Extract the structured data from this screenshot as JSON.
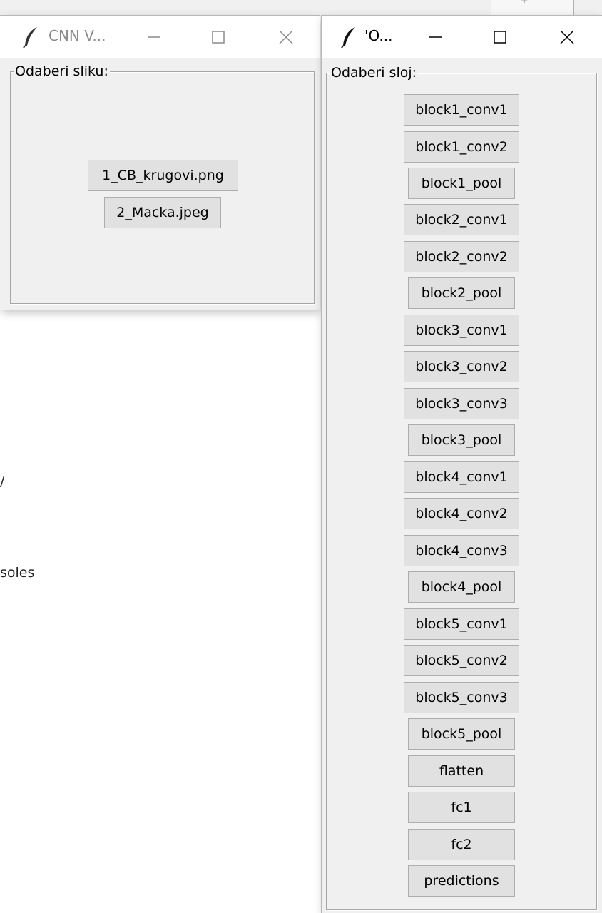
{
  "background": {
    "text_lines": [
      "/",
      "soles"
    ]
  },
  "window_images": {
    "title": "CNN V...",
    "frame_label": "Odaberi sliku:",
    "buttons": [
      "1_CB_krugovi.png",
      "2_Macka.jpeg"
    ],
    "controls": [
      "minimize-icon",
      "maximize-icon",
      "close-icon"
    ]
  },
  "window_layers": {
    "title": "'O...",
    "frame_label": "Odaberi sloj:",
    "buttons": [
      "block1_conv1",
      "block1_conv2",
      "block1_pool",
      "block2_conv1",
      "block2_conv2",
      "block2_pool",
      "block3_conv1",
      "block3_conv2",
      "block3_conv3",
      "block3_pool",
      "block4_conv1",
      "block4_conv2",
      "block4_conv3",
      "block4_pool",
      "block5_conv1",
      "block5_conv2",
      "block5_conv3",
      "block5_pool",
      "flatten",
      "fc1",
      "fc2",
      "predictions"
    ],
    "controls": [
      "minimize-icon",
      "maximize-icon",
      "close-icon"
    ]
  },
  "colors": {
    "window_bg": "#f0f0f0",
    "titlebar_bg": "#ffffff",
    "button_bg": "#e1e1e1",
    "button_border": "#adadad",
    "inactive_title": "#8a8a8a"
  }
}
